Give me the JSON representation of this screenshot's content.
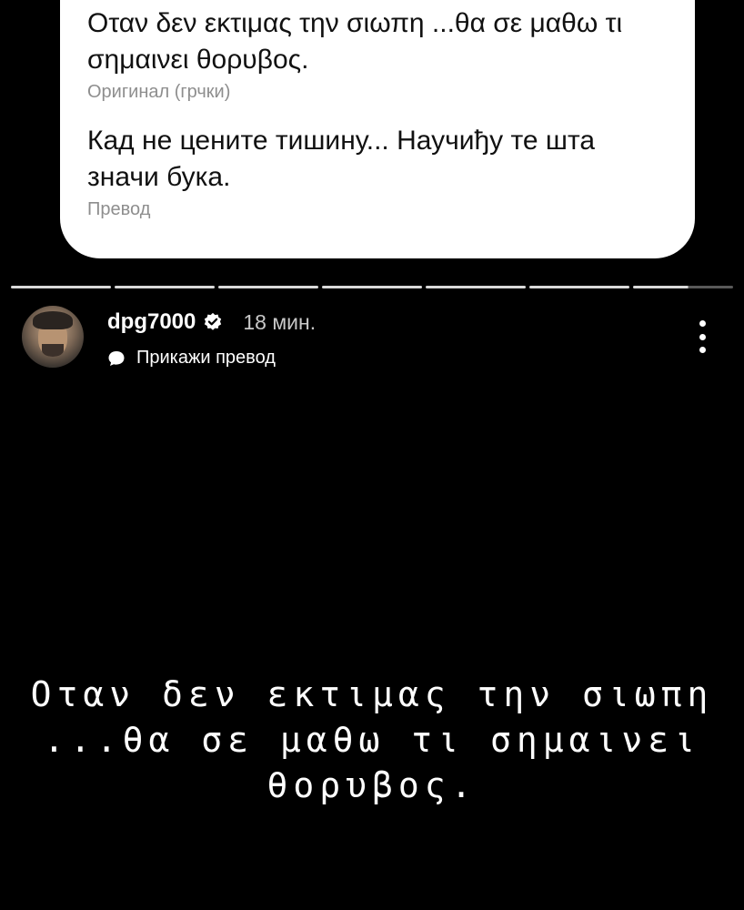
{
  "translation_card": {
    "original_text": "Οταν δεν εκτιμας την σιωπη ...θα σε μαθω τι σημαινει θορυβος.",
    "original_label": "Оригинал (грчки)",
    "translated_text": "Кад не цените тишину... Научиђу те шта значи бука.",
    "translated_label": "Превод"
  },
  "story_progress": {
    "segments": 7,
    "current_segment": 7,
    "current_fraction": 0.55
  },
  "header": {
    "username": "dpg7000",
    "verified": true,
    "timestamp": "18 мин.",
    "translate_action": "Прикажи превод",
    "icons": {
      "verified": "verified-badge-icon",
      "translate": "speech-bubble-icon",
      "more": "more-options-icon"
    }
  },
  "story": {
    "text_line1": "Οταν δεν εκτιμας την σιωπη",
    "text_line2": "...θα σε μαθω τι σημαινει",
    "text_line3": "θορυβος."
  },
  "colors": {
    "background": "#000000",
    "card": "#ffffff",
    "secondary_text": "#8e8e8e"
  }
}
